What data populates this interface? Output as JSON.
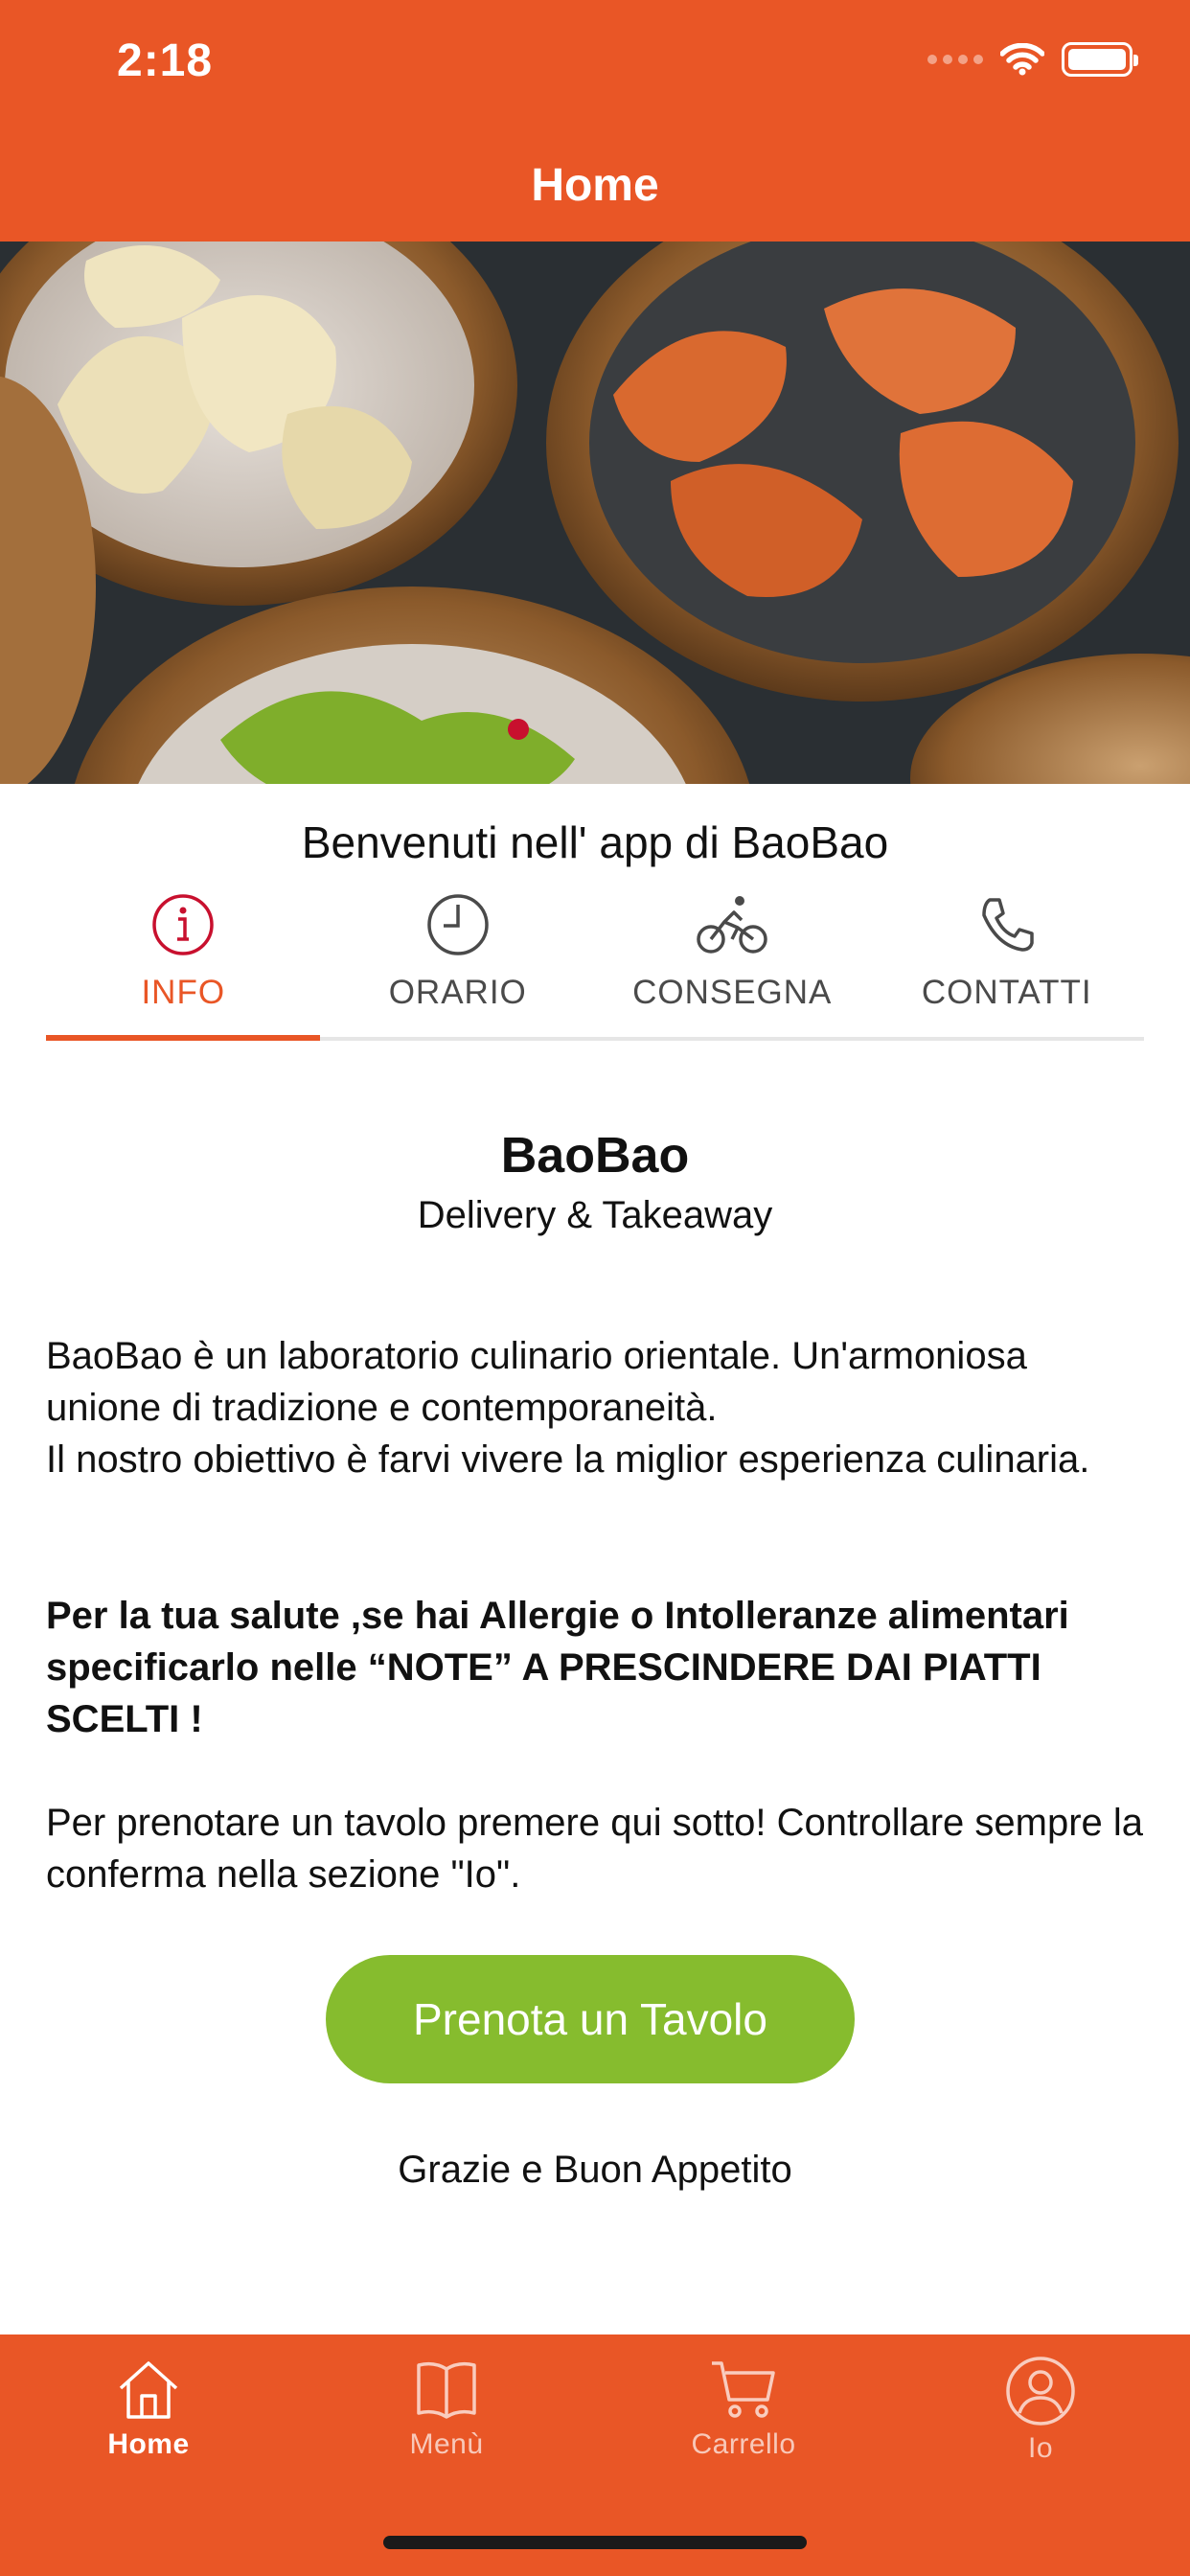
{
  "status_bar": {
    "time": "2:18"
  },
  "header": {
    "title": "Home"
  },
  "welcome_text": "Benvenuti nell' app di BaoBao",
  "info_tabs": [
    {
      "label": "INFO",
      "icon": "info-icon",
      "active": true
    },
    {
      "label": "ORARIO",
      "icon": "clock-icon",
      "active": false
    },
    {
      "label": "CONSEGNA",
      "icon": "bicycle-icon",
      "active": false
    },
    {
      "label": "CONTATTI",
      "icon": "phone-icon",
      "active": false
    }
  ],
  "content": {
    "brand": "BaoBao",
    "tagline": "Delivery & Takeaway",
    "paragraph1": "BaoBao è un laboratorio culinario orientale. Un'armoniosa unione di tradizione e contemporaneità.",
    "paragraph2": "Il nostro obiettivo è farvi vivere la miglior esperienza culinaria.",
    "allergy_notice": "Per la tua salute ,se hai Allergie o Intolleranze alimentari specificarlo nelle “NOTE” A PRESCINDERE DAI PIATTI SCELTI !",
    "reservation_text": "Per prenotare un tavolo premere qui sotto! Controllare sempre la conferma nella sezione \"Io\".",
    "reserve_button": "Prenota un Tavolo",
    "thanks": "Grazie e Buon Appetito"
  },
  "bottom_nav": [
    {
      "label": "Home",
      "icon": "house-icon",
      "active": true
    },
    {
      "label": "Menù",
      "icon": "book-icon",
      "active": false
    },
    {
      "label": "Carrello",
      "icon": "cart-icon",
      "active": false
    },
    {
      "label": "Io",
      "icon": "user-icon",
      "active": false
    }
  ],
  "colors": {
    "primary": "#E95626",
    "active_tab_icon": "#C8102E",
    "button": "#86BC2E"
  }
}
